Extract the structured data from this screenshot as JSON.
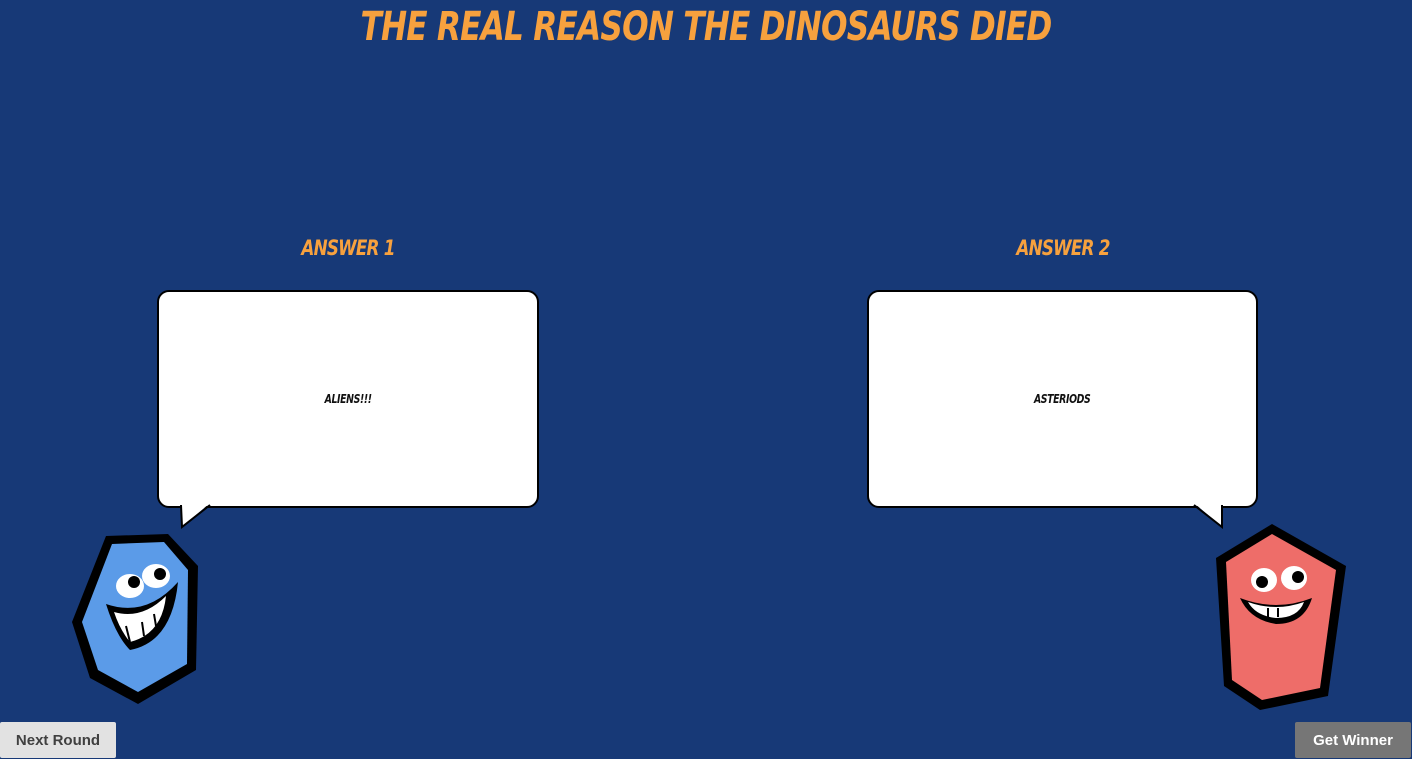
{
  "title": "THE REAL REASON THE DINOSAURS DIED",
  "answers": [
    {
      "heading": "ANSWER 1",
      "text": "ALIENS!!!"
    },
    {
      "heading": "ANSWER 2",
      "text": "ASTERIODS"
    }
  ],
  "buttons": {
    "next_round": "Next Round",
    "get_winner": "Get Winner"
  },
  "characters": [
    {
      "name": "blue-creature",
      "color": "#5B9BE8"
    },
    {
      "name": "red-creature",
      "color": "#EE6D69"
    }
  ],
  "colors": {
    "background": "#173977",
    "accent": "#F7A13E"
  }
}
